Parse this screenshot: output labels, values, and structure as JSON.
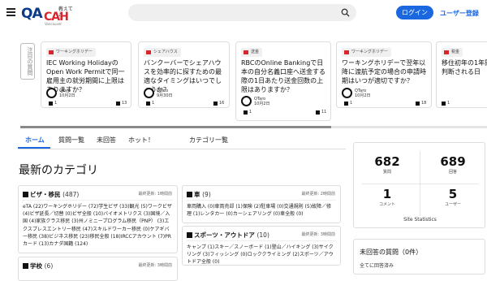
{
  "header": {
    "logo_main": "QA",
    "logo_brand": "CAH",
    "logo_tagline": "教えて♪",
    "logo_sub": "Vancouver",
    "search_placeholder": "",
    "login_label": "ログイン",
    "register_label": "ユーザー登録",
    "accent_color": "#1a67e0"
  },
  "featured": {
    "label": "注目の質問",
    "cards": [
      {
        "tag": "ワーキングホリデー",
        "title": "IEC Working HolidayのOpen Work Permitで同一雇用主の就労期間に上限はありますか？",
        "user": "QTaro",
        "date": "10月2日",
        "left_count": "1",
        "right_count": "13"
      },
      {
        "tag": "シェアハウス",
        "title": "バンクーバーでシェアハウスを効率的に探すための最適なタイミングはいつでしょうか？",
        "user": "QTaro",
        "date": "9月30日",
        "left_count": "1",
        "right_count": "16"
      },
      {
        "tag": "送金",
        "title": "RBCのOnline Bankingで日本の自分名義口座へ送金する際の1日あたり送金回数の上限はありますか？",
        "user": "QTaro",
        "date": "10月2日",
        "left_count": "1",
        "right_count": "11"
      },
      {
        "tag": "ワーキングホリデー",
        "title": "ワーキングホリデーで翌年以降に渡航予定の場合の申請時期はいつが適切ですか？",
        "user": "QTaro",
        "date": "10月2日",
        "left_count": "1",
        "right_count": "18"
      },
      {
        "tag": "税金",
        "title": "移住初年の1年間のみ居住者と判断される日",
        "user": "QTaro",
        "date": "",
        "left_count": "1",
        "right_count": ""
      }
    ]
  },
  "tabs": [
    "ホーム",
    "質問一覧",
    "未回答",
    "ホット！",
    "カテゴリ一覧"
  ],
  "main": {
    "heading": "最新のカテゴリ"
  },
  "categories": [
    {
      "name": "ビザ・移民",
      "count": "(487)",
      "updated": "最終更新: 1時間前",
      "body": "eTA (22)ワーキングホリデー (72)学生ビザ (33)観光 (5)ワークビザ (4)ビザ延長／切替 (0)ビザ全般 (10)バイオメトリクス (3)国境／入国 (4)家族クラス移民 (3)州ノミニープログラム移民（PNP） (3)エクスプレスエントリー移民 (47)スキルドワーカー移民 (0)ケアギバー移民 (38)ビジネス移民 (23)移民全般 (18)IRCCアカウント (7)PRカード (13)カナダ国籍 (124)"
    },
    {
      "name": "車",
      "count": "(9)",
      "updated": "最終更新: 2時間前",
      "body": "車両購入 (0)車両売却 (1)保険 (2)駐車場 (0)交通規則 (5)故障／修理 (1)レンタカー (0)カーシェアリング (0)車全般 (0)"
    },
    {
      "name": "スポーツ・アウトドア",
      "count": "(10)",
      "updated": "最終更新: 3時間前",
      "body": "キャンプ (1)スキー／スノーボード (1)登山／ハイキング (3)サイクリング (3)フィッシング (0)ロッククライミング (2)スポーツ／アウトドア全般 (0)"
    },
    {
      "name": "学校",
      "count": "(6)",
      "updated": "最終更新: 3時間前",
      "body": ""
    }
  ],
  "stats": {
    "items": [
      {
        "value": "682",
        "label": "質問"
      },
      {
        "value": "689",
        "label": "回答"
      },
      {
        "value": "1",
        "label": "コメント"
      },
      {
        "value": "5",
        "label": "ユーザー"
      }
    ],
    "caption": "Site Statistics"
  },
  "unanswered": {
    "title": "未回答の質問（0件）",
    "body": "全てに回答済み"
  }
}
